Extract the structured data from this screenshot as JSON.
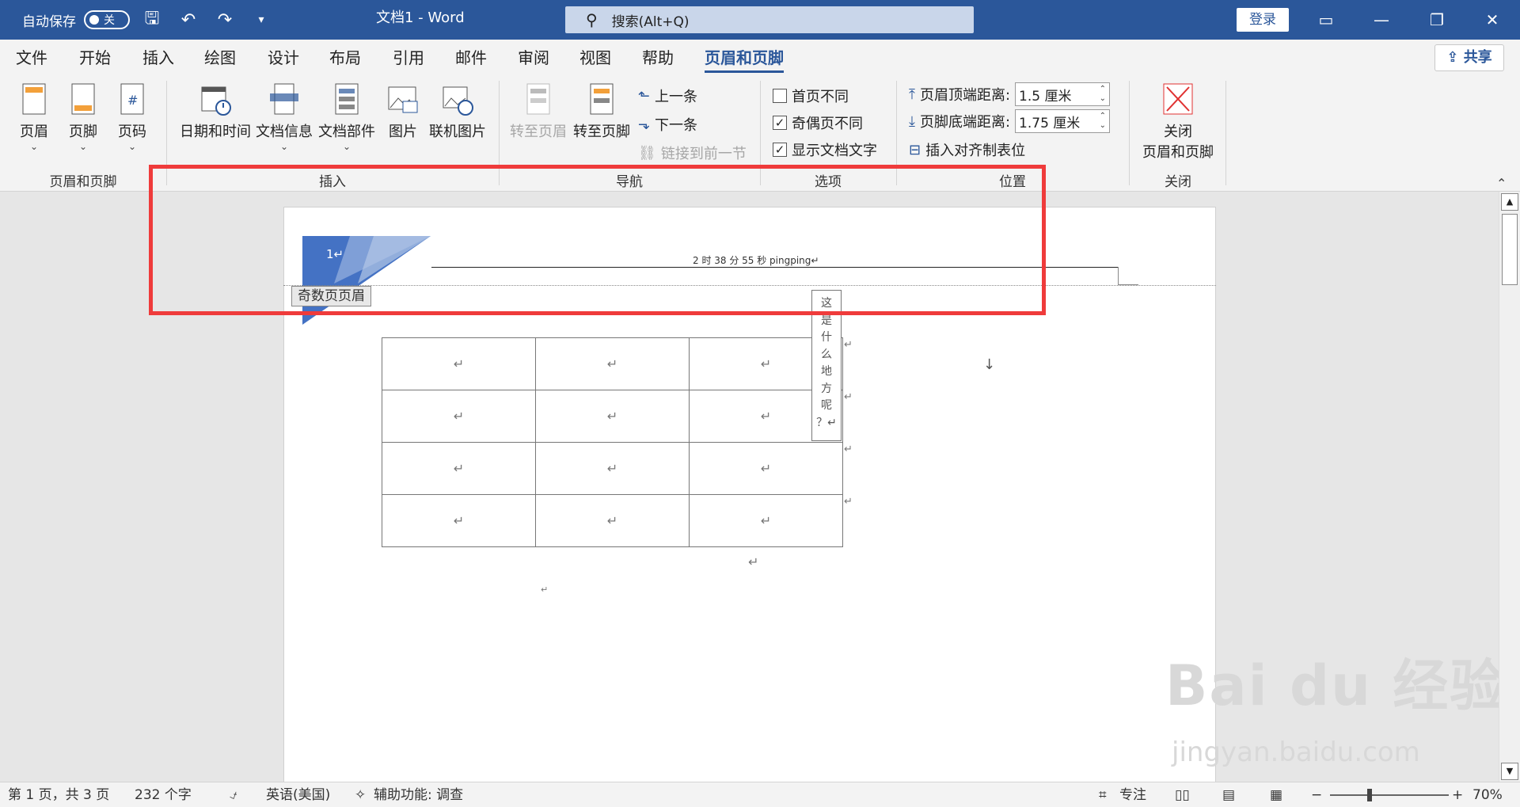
{
  "titlebar": {
    "autosave_label": "自动保存",
    "autosave_state": "关",
    "doc_title": "文档1  -  Word",
    "search_placeholder": "搜索(Alt+Q)",
    "login_label": "登录"
  },
  "tabs": [
    {
      "label": "文件"
    },
    {
      "label": "开始"
    },
    {
      "label": "插入"
    },
    {
      "label": "绘图"
    },
    {
      "label": "设计"
    },
    {
      "label": "布局"
    },
    {
      "label": "引用"
    },
    {
      "label": "邮件"
    },
    {
      "label": "审阅"
    },
    {
      "label": "视图"
    },
    {
      "label": "帮助"
    },
    {
      "label": "页眉和页脚"
    }
  ],
  "share_label": "共享",
  "ribbon": {
    "hf": {
      "header": "页眉",
      "footer": "页脚",
      "page_number": "页码",
      "group": "页眉和页脚"
    },
    "insert": {
      "datetime": "日期和时间",
      "docinfo": "文档信息",
      "quickparts": "文档部件",
      "picture": "图片",
      "online_picture": "联机图片",
      "group": "插入"
    },
    "nav": {
      "goto_header": "转至页眉",
      "goto_footer": "转至页脚",
      "previous": "上一条",
      "next": "下一条",
      "link_previous": "链接到前一节",
      "group": "导航"
    },
    "options": {
      "diff_first": "首页不同",
      "diff_odd_even": "奇偶页不同",
      "show_doc_text": "显示文档文字",
      "group": "选项"
    },
    "position": {
      "header_top_label": "页眉顶端距离:",
      "header_top_value": "1.5 厘米",
      "footer_bottom_label": "页脚底端距离:",
      "footer_bottom_value": "1.75 厘米",
      "insert_align_tab": "插入对齐制表位",
      "group": "位置"
    },
    "close": {
      "label_line1": "关闭",
      "label_line2": "页眉和页脚",
      "group": "关闭"
    }
  },
  "document": {
    "header_text": "2 时 38 分 55 秒 pingping↵",
    "page_number": "1↵",
    "odd_header_label": "奇数页页眉",
    "vertical_text": [
      "这",
      "是",
      "什",
      "么",
      "地",
      "方",
      "呢",
      "？↵"
    ],
    "cell_mark": "↵"
  },
  "statusbar": {
    "page_info": "第 1 页，共 3 页",
    "word_count": "232 个字",
    "language": "英语(美国)",
    "accessibility": "辅助功能: 调查",
    "focus": "专注",
    "zoom_percent": "70%",
    "zoom_level": 0.7
  },
  "watermark": {
    "logo": "Bai du 经验",
    "url": "jingyan.baidu.com"
  },
  "colors": {
    "title_blue": "#2b579a",
    "highlight_red": "#ef3b3b"
  }
}
